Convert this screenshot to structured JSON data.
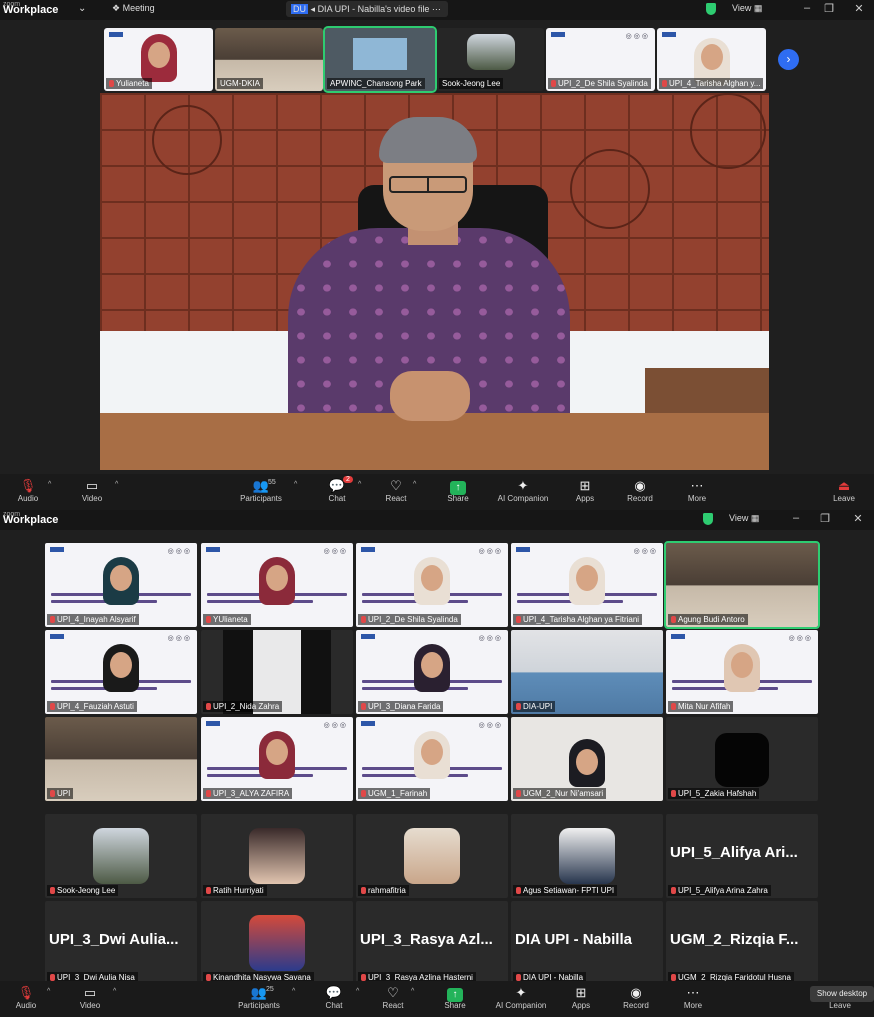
{
  "window1": {
    "app_small": "zoom",
    "app_big": "Workplace",
    "meeting_label": "Meeting",
    "share_tag": "DU",
    "share_title": "DIA UPI - Nabilla's video file",
    "view_label": "View",
    "strip": [
      {
        "name": "Yulianeta"
      },
      {
        "name": "UGM-DKIA"
      },
      {
        "name": "APWINC_Chansong Park"
      },
      {
        "name": "Sook-Jeong Lee"
      },
      {
        "name": "UPI_2_De Shila Syalinda"
      },
      {
        "name": "UPI_4_Tarisha Alghan y..."
      }
    ],
    "next_icon": "chevron-right-icon",
    "toolbar": {
      "audio": "Audio",
      "video": "Video",
      "participants": "Participants",
      "participants_count": "55",
      "chat": "Chat",
      "chat_badge": "2",
      "react": "React",
      "share": "Share",
      "ai": "AI Companion",
      "apps": "Apps",
      "record": "Record",
      "more": "More",
      "leave": "Leave"
    }
  },
  "window2": {
    "app_small": "zoom",
    "app_big": "Workplace",
    "view_label": "View",
    "grid": [
      {
        "name": "UPI_4_Inayah Alsyarif",
        "kind": "slide"
      },
      {
        "name": "YUlianeta",
        "kind": "slide"
      },
      {
        "name": "UPI_2_De Shila Syalinda",
        "kind": "slide"
      },
      {
        "name": "UPI_4_Tarisha Alghan ya Fitriani",
        "kind": "slide"
      },
      {
        "name": "Agung Budi Antoro",
        "kind": "room"
      },
      {
        "name": "UPI_4_Fauziah Astuti",
        "kind": "slide"
      },
      {
        "name": "UPI_2_Nida Zahra",
        "kind": "dark"
      },
      {
        "name": "UPI_3_Diana Farida",
        "kind": "slide"
      },
      {
        "name": "DIA-UPI",
        "kind": "room"
      },
      {
        "name": "Mita Nur Afifah",
        "kind": "slide"
      },
      {
        "name": "UPI",
        "kind": "room"
      },
      {
        "name": "UPI_3_ALYA ZAFIRA",
        "kind": "slide"
      },
      {
        "name": "UGM_1_Farinah",
        "kind": "slide"
      },
      {
        "name": "UGM_2_Nur Ni'amsari",
        "kind": "room"
      },
      {
        "name": "UPI_5_Zakia Hafshah",
        "kind": "dark"
      },
      {
        "name": "Sook-Jeong Lee",
        "kind": "avatar"
      },
      {
        "name": "Ratih Hurriyati",
        "kind": "avatar"
      },
      {
        "name": "rahmafitria",
        "kind": "avatar"
      },
      {
        "name": "Agus Setiawan- FPTI UPI",
        "kind": "avatar"
      },
      {
        "name": "UPI_5_Alifya Arina Zahra",
        "kind": "text",
        "big": "UPI_5_Alifya Ari..."
      },
      {
        "name": "UPI_3_Dwi Aulia Nisa",
        "kind": "text",
        "big": "UPI_3_Dwi Aulia..."
      },
      {
        "name": "Kinandhita Nasywa Savana",
        "kind": "avatar"
      },
      {
        "name": "UPI_3_Rasya Azlina Hasterni",
        "kind": "text",
        "big": "UPI_3_Rasya Azl..."
      },
      {
        "name": "DIA UPI - Nabilla",
        "kind": "text",
        "big": "DIA UPI - Nabilla"
      },
      {
        "name": "UGM_2_Rizqia Faridotul Husna",
        "kind": "text",
        "big": "UGM_2_Rizqia F..."
      }
    ],
    "toolbar": {
      "audio": "Audio",
      "video": "Video",
      "participants": "Participants",
      "participants_count": "25",
      "chat": "Chat",
      "react": "React",
      "share": "Share",
      "ai": "AI Companion",
      "apps": "Apps",
      "record": "Record",
      "more": "More",
      "leave": "Leave"
    },
    "show_desktop": "Show desktop"
  },
  "colors": {
    "accent_green": "#2ecc71",
    "leave_red": "#e23b3b",
    "share_green": "#23b35a",
    "nav_blue": "#2f6df2"
  }
}
